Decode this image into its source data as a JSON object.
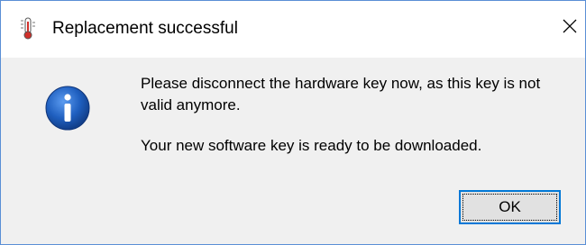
{
  "window": {
    "title": "Replacement successful",
    "app_icon": "thermometer-app-icon",
    "close_icon": "close-icon"
  },
  "message": {
    "icon": "information-icon",
    "line1": "Please disconnect the hardware key now, as this key is not valid anymore.",
    "line2": "Your new software key is ready to be downloaded."
  },
  "buttons": {
    "ok_label": "OK"
  },
  "colors": {
    "accent": "#0078d7",
    "window_border": "#5a8fd6",
    "dialog_background": "#f0f0f0",
    "titlebar_background": "#ffffff",
    "info_icon_blue": "#1f5fbf"
  }
}
